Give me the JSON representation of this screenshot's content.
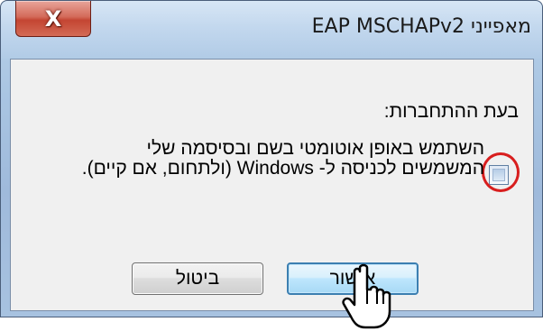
{
  "window": {
    "title": "מאפייני EAP MSCHAPv2",
    "close_icon": "X"
  },
  "dialog": {
    "heading": "בעת ההתחברות:",
    "checkbox": {
      "label": "השתמש באופן אוטומטי בשם ובסיסמה שלי המשמשים לכניסה ל- Windows (ולתחום, אם קיים).",
      "checked": false,
      "highlight_color": "#d81e1e"
    },
    "buttons": {
      "ok_label": "אישור",
      "cancel_label": "ביטול"
    },
    "cursor": "hand-pointer-icon"
  }
}
